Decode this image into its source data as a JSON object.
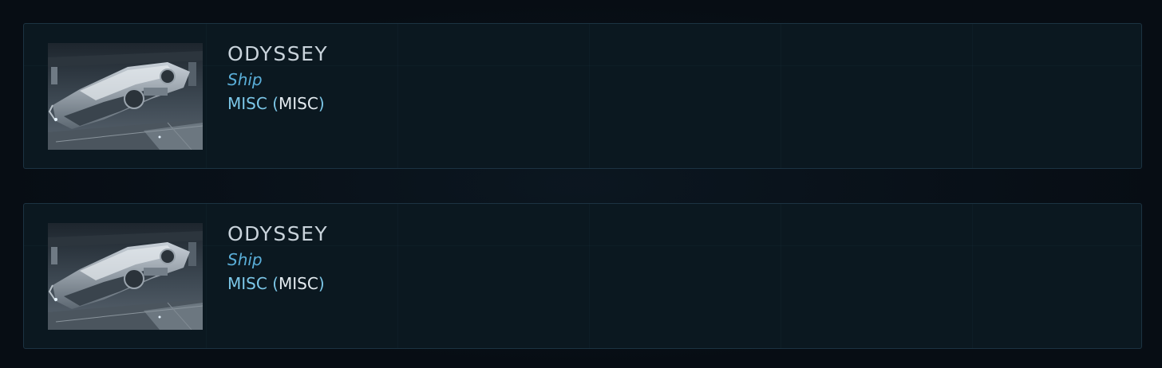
{
  "items": [
    {
      "name": "ODYSSEY",
      "type": "Ship",
      "manufacturer": "MISC",
      "paren_open": "(",
      "manufacturer_code": "MISC",
      "paren_close": ")",
      "thumbnail_icon": "ship-image"
    },
    {
      "name": "ODYSSEY",
      "type": "Ship",
      "manufacturer": "MISC",
      "paren_open": "(",
      "manufacturer_code": "MISC",
      "paren_close": ")",
      "thumbnail_icon": "ship-image"
    }
  ],
  "colors": {
    "background": "#070d14",
    "card": "#0b1820",
    "card_border": "#1c3342",
    "name": "#c9d3db",
    "type": "#5aaed8",
    "manufacturer": "#7cc7e8",
    "code": "#e4ebf0"
  }
}
